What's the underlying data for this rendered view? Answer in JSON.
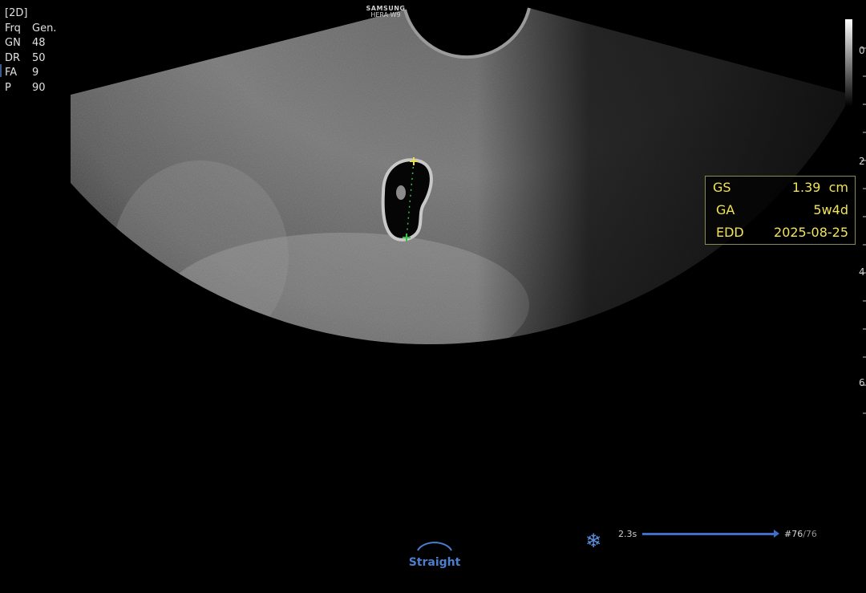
{
  "device": {
    "brand": "SAMSUNG",
    "model": "HERA W9"
  },
  "mode": "[2D]",
  "params": [
    {
      "key": "Frq",
      "value": "Gen."
    },
    {
      "key": "GN",
      "value": "48"
    },
    {
      "key": "DR",
      "value": "50"
    },
    {
      "key": "FA",
      "value": "9"
    },
    {
      "key": "P",
      "value": "90"
    }
  ],
  "depth_scale": [
    "0",
    "2",
    "4",
    "6"
  ],
  "measurement": {
    "gs": {
      "label": "GS",
      "value": "1.39  cm"
    },
    "ga": {
      "label": "GA",
      "value": "5w4d"
    },
    "edd": {
      "label": "EDD",
      "value": "2025-08-25"
    }
  },
  "probe_orientation": "Straight",
  "cine": {
    "duration": "2.3s",
    "frame": "#76",
    "total": "/76",
    "progress": 1.0
  },
  "colors": {
    "measurement_text": "#f1e35a",
    "accent_blue": "#3d6fc8",
    "caliper_start": "#e8e04a",
    "caliper_end": "#35c04a"
  }
}
